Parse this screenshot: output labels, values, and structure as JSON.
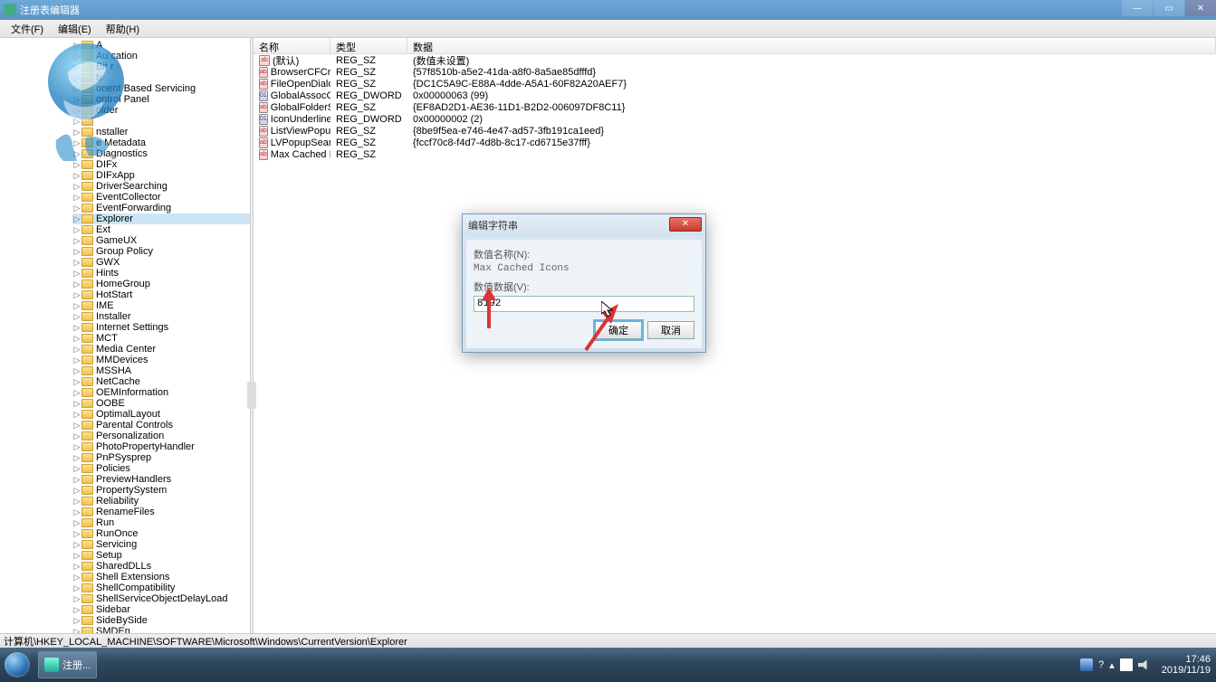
{
  "window": {
    "title": "注册表编辑器"
  },
  "menu": {
    "file": "文件(F)",
    "edit": "编辑(E)",
    "help": "帮助(H)"
  },
  "columns": {
    "name": "名称",
    "type": "类型",
    "data": "数据"
  },
  "tree": [
    "A",
    "Au       cation",
    "Bit    r",
    "   b",
    "   onent Based Servicing",
    "  ontrol Panel",
    "     older",
    "",
    "  nstaller",
    "   e Metadata",
    "Diagnostics",
    "DIFx",
    "DIFxApp",
    "DriverSearching",
    "EventCollector",
    "EventForwarding",
    "Explorer",
    "Ext",
    "GameUX",
    "Group Policy",
    "GWX",
    "Hints",
    "HomeGroup",
    "HotStart",
    "IME",
    "Installer",
    "Internet Settings",
    "MCT",
    "Media Center",
    "MMDevices",
    "MSSHA",
    "NetCache",
    "OEMInformation",
    "OOBE",
    "OptimalLayout",
    "Parental Controls",
    "Personalization",
    "PhotoPropertyHandler",
    "PnPSysprep",
    "Policies",
    "PreviewHandlers",
    "PropertySystem",
    "Reliability",
    "RenameFiles",
    "Run",
    "RunOnce",
    "Servicing",
    "Setup",
    "SharedDLLs",
    "Shell Extensions",
    "ShellCompatibility",
    "ShellServiceObjectDelayLoad",
    "Sidebar",
    "SideBySide",
    "SMDEn"
  ],
  "tree_selected": "Explorer",
  "values": [
    {
      "n": "(默认)",
      "t": "REG_SZ",
      "d": "(数值未设置)",
      "k": "sz"
    },
    {
      "n": "BrowserCFCreat...",
      "t": "REG_SZ",
      "d": "{57f8510b-a5e2-41da-a8f0-8a5ae85dfffd}",
      "k": "sz"
    },
    {
      "n": "FileOpenDialog",
      "t": "REG_SZ",
      "d": "{DC1C5A9C-E88A-4dde-A5A1-60F82A20AEF7}",
      "k": "sz"
    },
    {
      "n": "GlobalAssocCh...",
      "t": "REG_DWORD",
      "d": "0x00000063 (99)",
      "k": "dw"
    },
    {
      "n": "GlobalFolderSet...",
      "t": "REG_SZ",
      "d": "{EF8AD2D1-AE36-11D1-B2D2-006097DF8C11}",
      "k": "sz"
    },
    {
      "n": "IconUnderline",
      "t": "REG_DWORD",
      "d": "0x00000002 (2)",
      "k": "dw"
    },
    {
      "n": "ListViewPopup...",
      "t": "REG_SZ",
      "d": "{8be9f5ea-e746-4e47-ad57-3fb191ca1eed}",
      "k": "sz"
    },
    {
      "n": "LVPopupSearch...",
      "t": "REG_SZ",
      "d": "{fccf70c8-f4d7-4d8b-8c17-cd6715e37fff}",
      "k": "sz"
    },
    {
      "n": "Max Cached Ico...",
      "t": "REG_SZ",
      "d": "",
      "k": "sz"
    }
  ],
  "dialog": {
    "title": "编辑字符串",
    "name_label": "数值名称(N):",
    "name_value": "Max Cached Icons",
    "data_label": "数值数据(V):",
    "data_value": "8192",
    "ok": "确定",
    "cancel": "取消"
  },
  "statusbar": "计算机\\HKEY_LOCAL_MACHINE\\SOFTWARE\\Microsoft\\Windows\\CurrentVersion\\Explorer",
  "taskbar": {
    "task": "注册...",
    "time": "17:46",
    "date": "2019/11/19",
    "ime": "?"
  }
}
